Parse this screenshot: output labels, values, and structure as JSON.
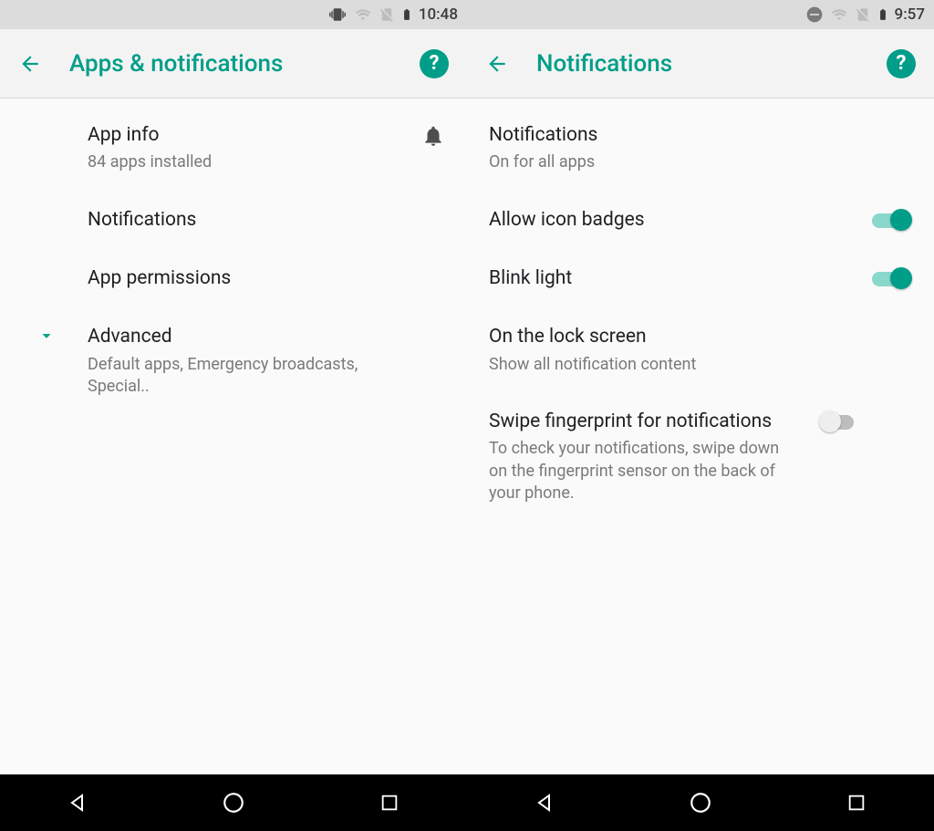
{
  "left": {
    "status": {
      "time": "10:48"
    },
    "appbar": {
      "title": "Apps & notifications",
      "help_label": "?"
    },
    "rows": {
      "app_info": {
        "title": "App info",
        "subtitle": "84 apps installed"
      },
      "notifications": {
        "title": "Notifications"
      },
      "app_permissions": {
        "title": "App permissions"
      },
      "advanced": {
        "title": "Advanced",
        "subtitle": "Default apps, Emergency broadcasts, Special.."
      }
    }
  },
  "right": {
    "status": {
      "time": "9:57"
    },
    "appbar": {
      "title": "Notifications",
      "help_label": "?"
    },
    "rows": {
      "notifications": {
        "title": "Notifications",
        "subtitle": "On for all apps"
      },
      "allow_icon_badges": {
        "title": "Allow icon badges",
        "toggle": true
      },
      "blink_light": {
        "title": "Blink light",
        "toggle": true
      },
      "lock_screen": {
        "title": "On the lock screen",
        "subtitle": "Show all notification content"
      },
      "swipe_fp": {
        "title": "Swipe fingerprint for notifications",
        "subtitle": "To check your notifications, swipe down on the fingerprint sensor on the back of your phone.",
        "toggle": false
      }
    }
  }
}
